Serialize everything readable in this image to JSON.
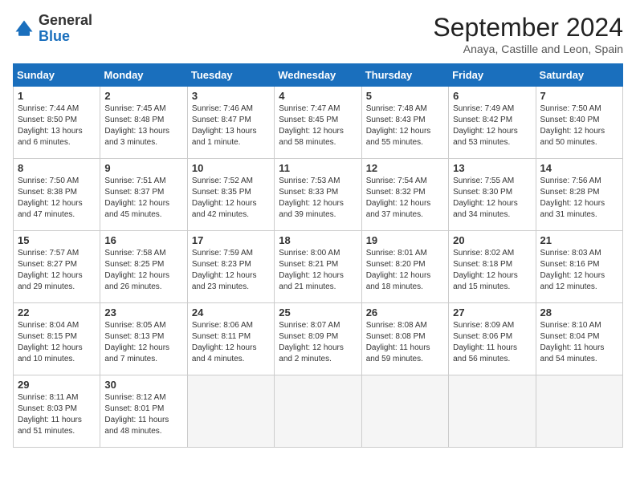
{
  "logo": {
    "general": "General",
    "blue": "Blue"
  },
  "header": {
    "month": "September 2024",
    "location": "Anaya, Castille and Leon, Spain"
  },
  "days_of_week": [
    "Sunday",
    "Monday",
    "Tuesday",
    "Wednesday",
    "Thursday",
    "Friday",
    "Saturday"
  ],
  "weeks": [
    [
      {
        "day": "1",
        "info": "Sunrise: 7:44 AM\nSunset: 8:50 PM\nDaylight: 13 hours and 6 minutes."
      },
      {
        "day": "2",
        "info": "Sunrise: 7:45 AM\nSunset: 8:48 PM\nDaylight: 13 hours and 3 minutes."
      },
      {
        "day": "3",
        "info": "Sunrise: 7:46 AM\nSunset: 8:47 PM\nDaylight: 13 hours and 1 minute."
      },
      {
        "day": "4",
        "info": "Sunrise: 7:47 AM\nSunset: 8:45 PM\nDaylight: 12 hours and 58 minutes."
      },
      {
        "day": "5",
        "info": "Sunrise: 7:48 AM\nSunset: 8:43 PM\nDaylight: 12 hours and 55 minutes."
      },
      {
        "day": "6",
        "info": "Sunrise: 7:49 AM\nSunset: 8:42 PM\nDaylight: 12 hours and 53 minutes."
      },
      {
        "day": "7",
        "info": "Sunrise: 7:50 AM\nSunset: 8:40 PM\nDaylight: 12 hours and 50 minutes."
      }
    ],
    [
      {
        "day": "8",
        "info": "Sunrise: 7:50 AM\nSunset: 8:38 PM\nDaylight: 12 hours and 47 minutes."
      },
      {
        "day": "9",
        "info": "Sunrise: 7:51 AM\nSunset: 8:37 PM\nDaylight: 12 hours and 45 minutes."
      },
      {
        "day": "10",
        "info": "Sunrise: 7:52 AM\nSunset: 8:35 PM\nDaylight: 12 hours and 42 minutes."
      },
      {
        "day": "11",
        "info": "Sunrise: 7:53 AM\nSunset: 8:33 PM\nDaylight: 12 hours and 39 minutes."
      },
      {
        "day": "12",
        "info": "Sunrise: 7:54 AM\nSunset: 8:32 PM\nDaylight: 12 hours and 37 minutes."
      },
      {
        "day": "13",
        "info": "Sunrise: 7:55 AM\nSunset: 8:30 PM\nDaylight: 12 hours and 34 minutes."
      },
      {
        "day": "14",
        "info": "Sunrise: 7:56 AM\nSunset: 8:28 PM\nDaylight: 12 hours and 31 minutes."
      }
    ],
    [
      {
        "day": "15",
        "info": "Sunrise: 7:57 AM\nSunset: 8:27 PM\nDaylight: 12 hours and 29 minutes."
      },
      {
        "day": "16",
        "info": "Sunrise: 7:58 AM\nSunset: 8:25 PM\nDaylight: 12 hours and 26 minutes."
      },
      {
        "day": "17",
        "info": "Sunrise: 7:59 AM\nSunset: 8:23 PM\nDaylight: 12 hours and 23 minutes."
      },
      {
        "day": "18",
        "info": "Sunrise: 8:00 AM\nSunset: 8:21 PM\nDaylight: 12 hours and 21 minutes."
      },
      {
        "day": "19",
        "info": "Sunrise: 8:01 AM\nSunset: 8:20 PM\nDaylight: 12 hours and 18 minutes."
      },
      {
        "day": "20",
        "info": "Sunrise: 8:02 AM\nSunset: 8:18 PM\nDaylight: 12 hours and 15 minutes."
      },
      {
        "day": "21",
        "info": "Sunrise: 8:03 AM\nSunset: 8:16 PM\nDaylight: 12 hours and 12 minutes."
      }
    ],
    [
      {
        "day": "22",
        "info": "Sunrise: 8:04 AM\nSunset: 8:15 PM\nDaylight: 12 hours and 10 minutes."
      },
      {
        "day": "23",
        "info": "Sunrise: 8:05 AM\nSunset: 8:13 PM\nDaylight: 12 hours and 7 minutes."
      },
      {
        "day": "24",
        "info": "Sunrise: 8:06 AM\nSunset: 8:11 PM\nDaylight: 12 hours and 4 minutes."
      },
      {
        "day": "25",
        "info": "Sunrise: 8:07 AM\nSunset: 8:09 PM\nDaylight: 12 hours and 2 minutes."
      },
      {
        "day": "26",
        "info": "Sunrise: 8:08 AM\nSunset: 8:08 PM\nDaylight: 11 hours and 59 minutes."
      },
      {
        "day": "27",
        "info": "Sunrise: 8:09 AM\nSunset: 8:06 PM\nDaylight: 11 hours and 56 minutes."
      },
      {
        "day": "28",
        "info": "Sunrise: 8:10 AM\nSunset: 8:04 PM\nDaylight: 11 hours and 54 minutes."
      }
    ],
    [
      {
        "day": "29",
        "info": "Sunrise: 8:11 AM\nSunset: 8:03 PM\nDaylight: 11 hours and 51 minutes."
      },
      {
        "day": "30",
        "info": "Sunrise: 8:12 AM\nSunset: 8:01 PM\nDaylight: 11 hours and 48 minutes."
      },
      {
        "day": "",
        "info": ""
      },
      {
        "day": "",
        "info": ""
      },
      {
        "day": "",
        "info": ""
      },
      {
        "day": "",
        "info": ""
      },
      {
        "day": "",
        "info": ""
      }
    ]
  ]
}
